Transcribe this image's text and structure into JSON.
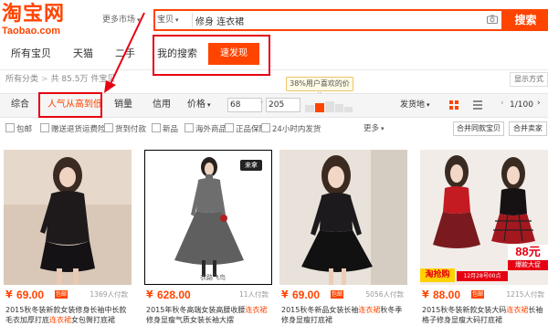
{
  "header": {
    "logo_text": "淘宝网",
    "logo_sub": "Taobao.com",
    "market_selector": "更多市场",
    "search": {
      "scope": "宝贝",
      "query": "修身 连衣裙",
      "button_label": "搜索"
    }
  },
  "tabs": {
    "all": "所有宝贝",
    "tmall": "天猫",
    "secondhand": "二手",
    "my_search": "我的搜索",
    "discover": "速发现"
  },
  "breadcrumb": {
    "home": "所有分类",
    "result": "共 85.5万 件宝贝",
    "display": "显示方式"
  },
  "price_hint": "38%用户喜欢的价位",
  "sortbar": {
    "default": "综合",
    "popular": "人气从高到低",
    "sales": "销量",
    "credit": "信用",
    "price": "价格",
    "price_min": "68",
    "price_max": "205",
    "ship_from": "发货地",
    "page_info": "1/100"
  },
  "filters": [
    "包邮",
    "赠送退货运费险",
    "货到付款",
    "新品",
    "海外商品",
    "正品保障",
    "24小时内发货"
  ],
  "more_filters": "更多",
  "buttons": {
    "merge": "合并同款宝贝",
    "similar": "合并卖家"
  },
  "products": [
    {
      "price": "69.00",
      "badge": "包邮",
      "payers": "1369人付款",
      "title_hl": "",
      "title_rest": "2015秋冬装新款女装修身长袖中长款毛衣加厚打底",
      "title_mid": "连衣裙",
      "title_tail": "女包臀打底裙"
    },
    {
      "price": "628.00",
      "badge": "",
      "payers": "11人付款",
      "title_hl": "",
      "title_rest": "2015年秋冬高端女装高腰收腰",
      "title_mid": "连衣裙",
      "title_tail": "修身显瘦气质女装长袖大摆"
    },
    {
      "price": "69.00",
      "badge": "包邮",
      "payers": "5056人付款",
      "title_hl": "",
      "title_rest": "2015秋冬新品女装长袖",
      "title_mid": "连衣裙",
      "title_tail": "秋冬季修身显瘦打底裙"
    },
    {
      "price": "88.00",
      "badge": "包邮",
      "payers": "1215人付款",
      "title_hl": "",
      "title_rest": "2015秋冬装新款女装大码",
      "title_mid": "连衣裙",
      "title_tail": "长袖格子修身显瘦大码打底裙"
    }
  ],
  "stickers": {
    "p2_tag": "来拿",
    "p2_watermark": "衣路飞鸟",
    "p4_price": "88元",
    "p4_promo": "爆款大促",
    "p4_brand": "淘抢购",
    "p4_date": "12月28号00点"
  },
  "colors": {
    "brand": "#ff4400",
    "annotation": "#e60012"
  }
}
